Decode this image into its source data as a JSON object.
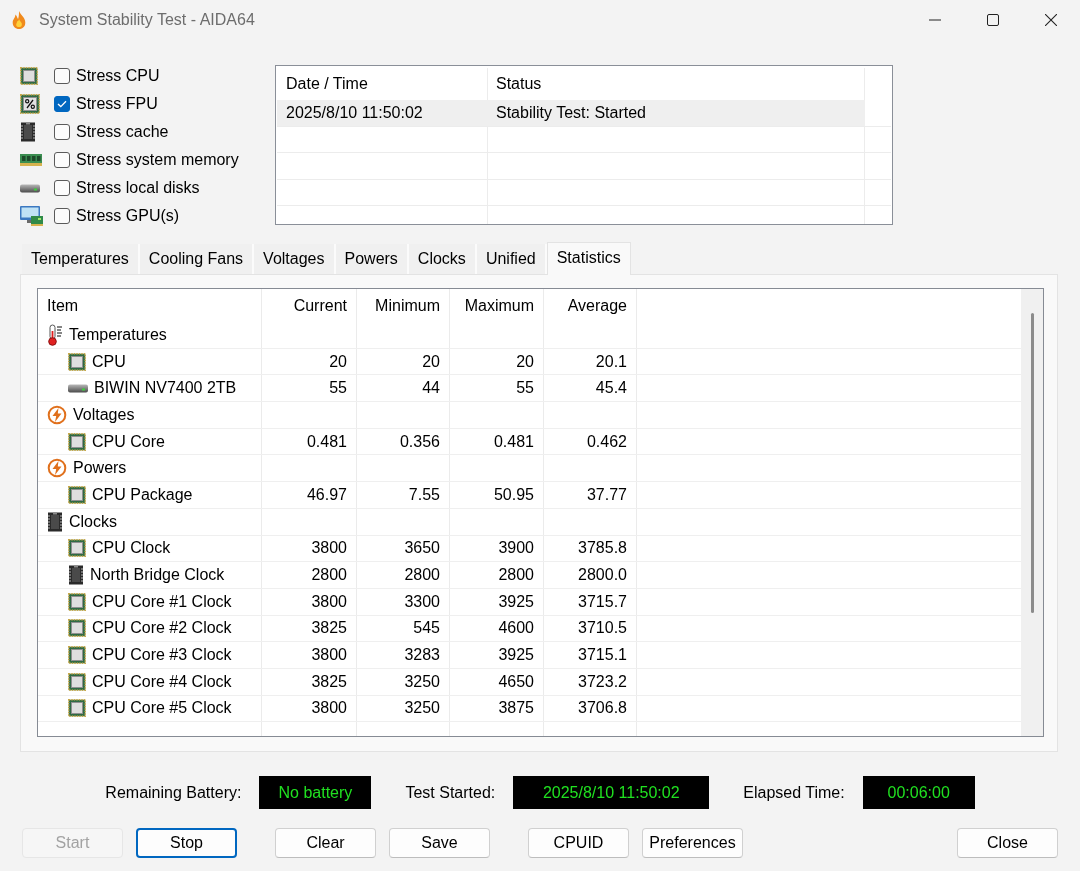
{
  "window": {
    "title": "System Stability Test - AIDA64"
  },
  "stress_options": [
    {
      "kind": "cpu",
      "label": "Stress CPU",
      "checked": false
    },
    {
      "kind": "fpu",
      "label": "Stress FPU",
      "checked": true
    },
    {
      "kind": "cache",
      "label": "Stress cache",
      "checked": false
    },
    {
      "kind": "memory",
      "label": "Stress system memory",
      "checked": false
    },
    {
      "kind": "disk",
      "label": "Stress local disks",
      "checked": false
    },
    {
      "kind": "gpu",
      "label": "Stress GPU(s)",
      "checked": false
    }
  ],
  "log": {
    "columns": [
      "Date / Time",
      "Status"
    ],
    "rows": [
      {
        "cells": [
          "2025/8/10 11:50:02",
          "Stability Test: Started"
        ],
        "selected": true
      }
    ]
  },
  "tabs": [
    {
      "label": "Temperatures",
      "selected": false
    },
    {
      "label": "Cooling Fans",
      "selected": false
    },
    {
      "label": "Voltages",
      "selected": false
    },
    {
      "label": "Powers",
      "selected": false
    },
    {
      "label": "Clocks",
      "selected": false
    },
    {
      "label": "Unified",
      "selected": false
    },
    {
      "label": "Statistics",
      "selected": true
    }
  ],
  "statistics": {
    "columns": [
      "Item",
      "Current",
      "Minimum",
      "Maximum",
      "Average"
    ],
    "rows": [
      {
        "kind": "temperature",
        "item": "Temperatures",
        "children": [
          {
            "kind": "cpu",
            "item": "CPU",
            "values": [
              "20",
              "20",
              "20",
              "20.1"
            ]
          },
          {
            "kind": "disk",
            "item": "BIWIN NV7400 2TB",
            "values": [
              "55",
              "44",
              "55",
              "45.4"
            ]
          }
        ]
      },
      {
        "kind": "voltage",
        "item": "Voltages",
        "children": [
          {
            "kind": "cpu",
            "item": "CPU Core",
            "values": [
              "0.481",
              "0.356",
              "0.481",
              "0.462"
            ]
          }
        ]
      },
      {
        "kind": "power",
        "item": "Powers",
        "children": [
          {
            "kind": "cpu",
            "item": "CPU Package",
            "values": [
              "46.97",
              "7.55",
              "50.95",
              "37.77"
            ]
          }
        ]
      },
      {
        "kind": "clock",
        "item": "Clocks",
        "children": [
          {
            "kind": "cpu",
            "item": "CPU Clock",
            "values": [
              "3800",
              "3650",
              "3900",
              "3785.8"
            ]
          },
          {
            "kind": "chip",
            "item": "North Bridge Clock",
            "values": [
              "2800",
              "2800",
              "2800",
              "2800.0"
            ]
          },
          {
            "kind": "cpu",
            "item": "CPU Core #1 Clock",
            "values": [
              "3800",
              "3300",
              "3925",
              "3715.7"
            ]
          },
          {
            "kind": "cpu",
            "item": "CPU Core #2 Clock",
            "values": [
              "3825",
              "545",
              "4600",
              "3710.5"
            ]
          },
          {
            "kind": "cpu",
            "item": "CPU Core #3 Clock",
            "values": [
              "3800",
              "3283",
              "3925",
              "3715.1"
            ]
          },
          {
            "kind": "cpu",
            "item": "CPU Core #4 Clock",
            "values": [
              "3825",
              "3250",
              "4650",
              "3723.2"
            ]
          },
          {
            "kind": "cpu",
            "item": "CPU Core #5 Clock",
            "values": [
              "3800",
              "3250",
              "3875",
              "3706.8"
            ]
          }
        ]
      }
    ]
  },
  "status": [
    {
      "label": "Remaining Battery:",
      "value": "No battery"
    },
    {
      "label": "Test Started:",
      "value": "2025/8/10 11:50:02"
    },
    {
      "label": "Elapsed Time:",
      "value": "00:06:00"
    }
  ],
  "button_groups": [
    {
      "buttons": [
        {
          "label": "Start",
          "disabled": true,
          "focused": false
        },
        {
          "label": "Stop",
          "disabled": false,
          "focused": true
        }
      ]
    },
    {
      "buttons": [
        {
          "label": "Clear",
          "disabled": false,
          "focused": false
        },
        {
          "label": "Save",
          "disabled": false,
          "focused": false
        }
      ]
    },
    {
      "buttons": [
        {
          "label": "CPUID",
          "disabled": false,
          "focused": false
        },
        {
          "label": "Preferences",
          "disabled": false,
          "focused": false
        }
      ]
    },
    {
      "buttons": [
        {
          "label": "Close",
          "disabled": false,
          "focused": false
        }
      ]
    }
  ]
}
